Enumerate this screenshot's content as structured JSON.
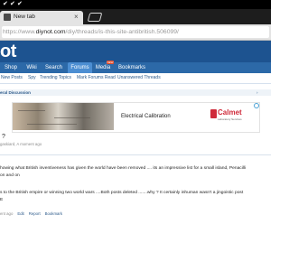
{
  "status_bar": {
    "checks": [
      "✔",
      "✔",
      "✔"
    ]
  },
  "browser": {
    "tab_title": "New tab",
    "tab_close": "×",
    "url_prefix": "https://www.",
    "url_host": "diynot.com",
    "url_path": "/diy/threads/is-this-site-antibritish.506099/"
  },
  "site": {
    "logo": "ot",
    "nav": [
      "Shop",
      "Wiki",
      "Search",
      "Forums",
      "Media",
      "Bookmarks"
    ],
    "media_badge": "NEW",
    "subnav": [
      "New Posts",
      "Spy",
      "Trending Topics",
      "Mark Forums Read",
      "Unanswered Threads"
    ]
  },
  "breadcrumb": {
    "label": "eral Discussion",
    "end": "›"
  },
  "ad": {
    "title": "Electrical Calibration",
    "logo": "Calmet",
    "logo_sub": "Laboratory Services"
  },
  "thread": {
    "title": "?",
    "meta": "gaskiard, A moment ago"
  },
  "post": {
    "lines": [
      "howing what British inventiveness has given the world have been removed .... its an impressive list for a small island, Penacilli",
      "on and on",
      "s to the British empire or winning two world wars ....Both posts deleted .......why ? It certainly inhuman wasn't a jingoistic post",
      "E"
    ],
    "meta": "ent ago",
    "actions": [
      "Edit",
      "Report",
      "Bookmark"
    ]
  },
  "colors": {
    "header": "#1d5390",
    "nav": "#2c69a8",
    "nav_active": "#4c8ed2",
    "link": "#2c5a8a",
    "ad_brand": "#cf2a3a"
  },
  "icons": [
    "tab-favicon-icon",
    "close-icon",
    "new-tab-icon",
    "ad-choices-icon",
    "calmet-logo-icon"
  ]
}
